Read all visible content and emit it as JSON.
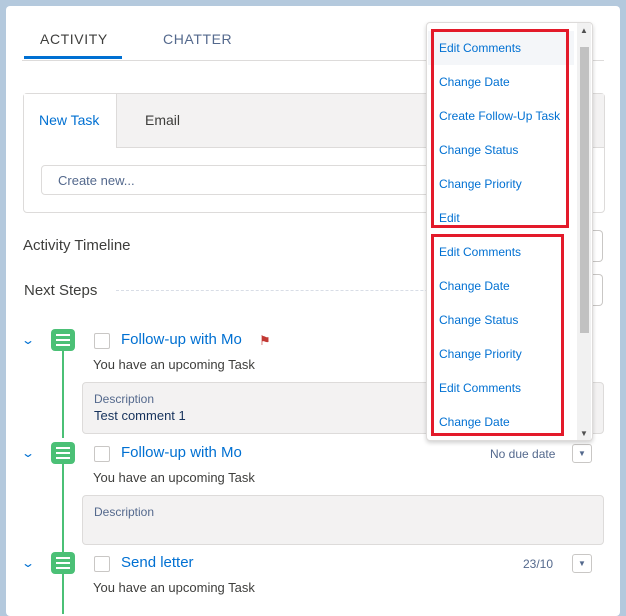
{
  "tabs": {
    "activity": "ACTIVITY",
    "chatter": "CHATTER"
  },
  "composer": {
    "new_task": "New Task",
    "email": "Email",
    "create_placeholder": "Create new..."
  },
  "timeline": {
    "title": "Activity Timeline",
    "next_steps": "Next Steps"
  },
  "tasks": [
    {
      "title": "Follow-up with Mo",
      "sub": "You have an upcoming Task",
      "desc_label": "Description",
      "desc_text": "Test comment 1",
      "due": "",
      "flagged": true
    },
    {
      "title": "Follow-up with Mo",
      "sub": "You have an upcoming Task",
      "desc_label": "Description",
      "desc_text": "",
      "due": "No due date",
      "flagged": false
    },
    {
      "title": "Send letter",
      "sub": "You have an upcoming Task",
      "due": "23/10",
      "flagged": false
    }
  ],
  "menu": {
    "items": [
      "Edit Comments",
      "Change Date",
      "Create Follow-Up Task",
      "Change Status",
      "Change Priority",
      "Edit",
      "Edit Comments",
      "Change Date",
      "Change Status",
      "Change Priority",
      "Edit Comments",
      "Change Date"
    ]
  },
  "colors": {
    "link": "#0070d2",
    "task_green": "#4bc076",
    "highlight_red": "#e31a2a",
    "flag_red": "#c23934"
  },
  "icons": {
    "expand": "chevron-down-icon",
    "task": "task-icon",
    "flag": "flag-icon",
    "dropdown": "triangle-down-icon"
  }
}
